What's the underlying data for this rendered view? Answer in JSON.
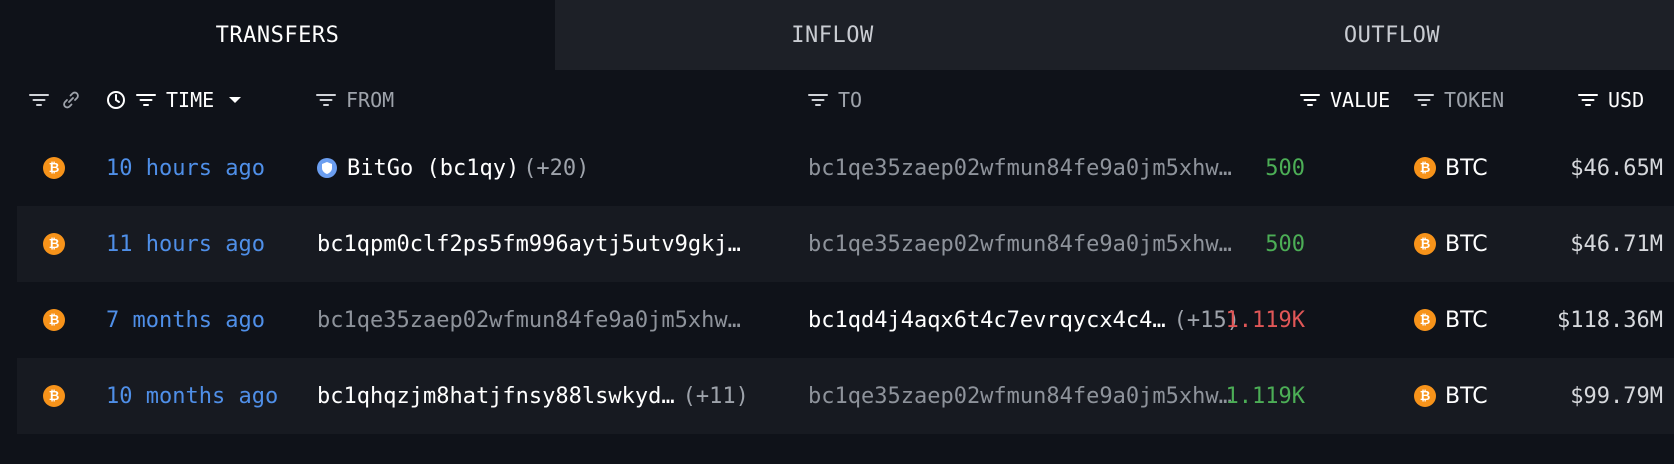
{
  "tabs": [
    {
      "label": "TRANSFERS",
      "active": true
    },
    {
      "label": "INFLOW",
      "active": false
    },
    {
      "label": "OUTFLOW",
      "active": false
    }
  ],
  "columns": {
    "time": "TIME",
    "from": "FROM",
    "to": "TO",
    "value": "VALUE",
    "token": "TOKEN",
    "usd": "USD"
  },
  "colors": {
    "accent_blue": "#4f8fe8",
    "positive": "#4cae56",
    "negative": "#e05757",
    "btc_orange": "#f7931a"
  },
  "rows": [
    {
      "time": "10 hours ago",
      "from": "BitGo (bc1qy)",
      "from_extra": "(+20)",
      "from_has_entity_icon": true,
      "to": "bc1qe35zaep02wfmun84fe9a0jm5xhw…",
      "to_extra": "",
      "value": "500",
      "value_color": "positive",
      "token": "BTC",
      "usd": "$46.65M"
    },
    {
      "time": "11 hours ago",
      "from": "bc1qpm0clf2ps5fm996aytj5utv9gkj…",
      "from_extra": "",
      "to": "bc1qe35zaep02wfmun84fe9a0jm5xhw…",
      "to_extra": "",
      "value": "500",
      "value_color": "positive",
      "token": "BTC",
      "usd": "$46.71M"
    },
    {
      "time": "7 months ago",
      "from": "bc1qe35zaep02wfmun84fe9a0jm5xhw…",
      "from_extra": "",
      "to": "bc1qd4j4aqx6t4c7evrqycx4c4…",
      "to_extra": "(+15)",
      "value": "1.119K",
      "value_color": "negative",
      "token": "BTC",
      "usd": "$118.36M"
    },
    {
      "time": "10 months ago",
      "from": "bc1qhqzjm8hatjfnsy88lswkyd…",
      "from_extra": "(+11)",
      "to": "bc1qe35zaep02wfmun84fe9a0jm5xhw…",
      "to_extra": "",
      "value": "1.119K",
      "value_color": "positive",
      "token": "BTC",
      "usd": "$99.79M"
    }
  ]
}
